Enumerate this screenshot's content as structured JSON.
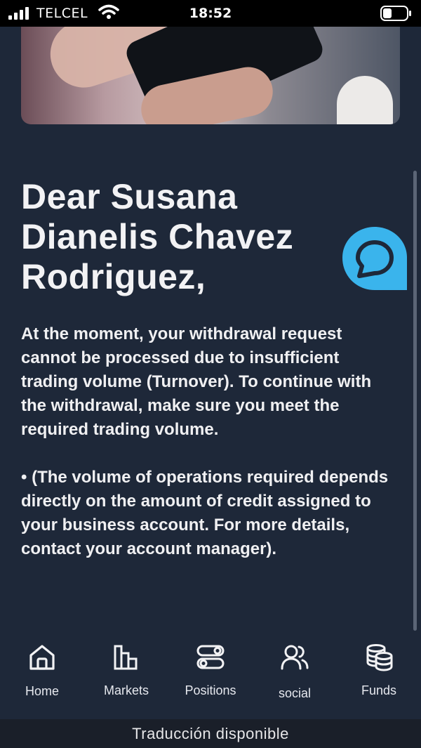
{
  "status_bar": {
    "carrier": "TELCEL",
    "time": "18:52"
  },
  "hero": {
    "image": "smartphone-trading-photo"
  },
  "greeting": "Dear Susana Dianelis Chavez Rodriguez,",
  "message": {
    "paragraph_1": "At the moment, your withdrawal request cannot be processed due to insufficient trading volume (Turnover). To continue with the withdrawal, make sure you meet the required trading volume.",
    "paragraph_2": "• (The volume of operations required depends directly on the amount of credit assigned to your business account. For more details, contact your account manager)."
  },
  "chat_button": {
    "icon": "chat-bubble-icon",
    "color": "#3ab4ec"
  },
  "bottom_nav": {
    "items": [
      {
        "label": "Home",
        "icon": "home-icon"
      },
      {
        "label": "Markets",
        "icon": "bar-chart-icon"
      },
      {
        "label": "Positions",
        "icon": "toggles-icon"
      },
      {
        "label": "social",
        "icon": "users-icon"
      },
      {
        "label": "Funds",
        "icon": "coins-stack-icon"
      }
    ]
  },
  "translation_bar": {
    "text": "Traducción disponible"
  },
  "colors": {
    "background": "#1e2839",
    "text": "#ffffff",
    "accent": "#3ab4ec"
  }
}
